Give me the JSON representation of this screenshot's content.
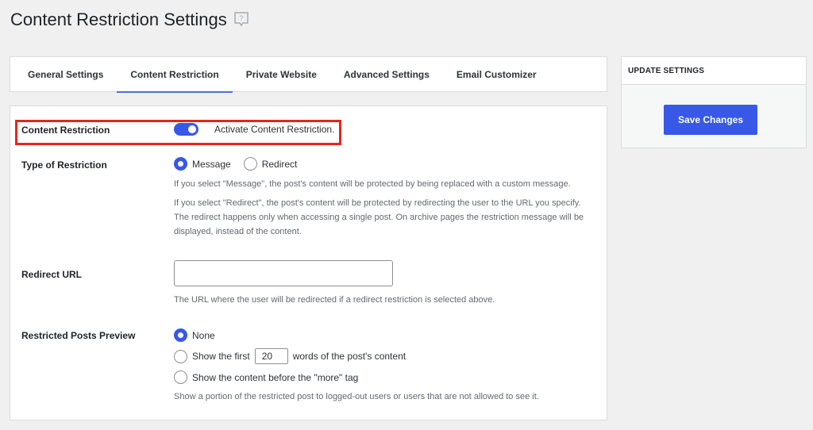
{
  "page": {
    "title": "Content Restriction Settings",
    "help_icon": "help-question-icon"
  },
  "tabs": [
    {
      "label": "General Settings",
      "active": false
    },
    {
      "label": "Content Restriction",
      "active": true
    },
    {
      "label": "Private Website",
      "active": false
    },
    {
      "label": "Advanced Settings",
      "active": false
    },
    {
      "label": "Email Customizer",
      "active": false
    }
  ],
  "colors": {
    "accent": "#3858e9",
    "tab_underline": "#4a6ee0",
    "highlight_border": "#e8241c"
  },
  "content_restriction": {
    "label": "Content Restriction",
    "toggle_on": true,
    "toggle_text": "Activate Content Restriction."
  },
  "type_of_restriction": {
    "label": "Type of Restriction",
    "options": [
      {
        "label": "Message",
        "checked": true
      },
      {
        "label": "Redirect",
        "checked": false
      }
    ],
    "desc_message": "If you select \"Message\", the post's content will be protected by being replaced with a custom message.",
    "desc_redirect": "If you select \"Redirect\", the post's content will be protected by redirecting the user to the URL you specify. The redirect happens only when accessing a single post. On archive pages the restriction message will be displayed, instead of the content."
  },
  "redirect_url": {
    "label": "Redirect URL",
    "value": "",
    "desc": "The URL where the user will be redirected if a redirect restriction is selected above."
  },
  "restricted_posts_preview": {
    "label": "Restricted Posts Preview",
    "option_none": "None",
    "option_first_prefix": "Show the first",
    "option_first_words": "20",
    "option_first_suffix": "words of the post's content",
    "option_more_tag": "Show the content before the \"more\" tag",
    "selected": "None",
    "desc": "Show a portion of the restricted post to logged-out users or users that are not allowed to see it."
  },
  "sidebar": {
    "header": "UPDATE SETTINGS",
    "save_label": "Save Changes"
  }
}
